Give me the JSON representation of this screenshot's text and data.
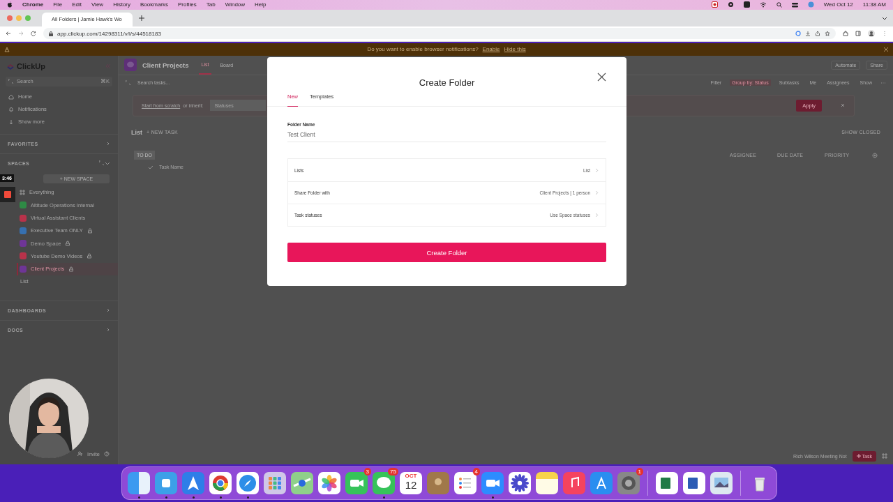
{
  "menubar": {
    "app": "Chrome",
    "menus": [
      "File",
      "Edit",
      "View",
      "History",
      "Bookmarks",
      "Profiles",
      "Tab",
      "Window",
      "Help"
    ],
    "date": "Wed Oct 12",
    "time": "11:38 AM"
  },
  "browser": {
    "tab_title": "All Folders | Jamie Hawk's Wo",
    "url": "app.clickup.com/14298311/v/l/s/44518183"
  },
  "notification": {
    "message": "Do you want to enable browser notifications?",
    "links": [
      "Enable",
      "Hide this"
    ]
  },
  "sidebar": {
    "logo": "ClickUp",
    "search_placeholder": "Search",
    "shortcut": "⌘K",
    "nav": [
      "Home",
      "Notifications",
      "Show more"
    ],
    "favorites": "FAVORITES",
    "spaces_label": "SPACES",
    "new_space": "+ NEW SPACE",
    "spaces": [
      {
        "kind": "everything",
        "name": "Everything",
        "locked": false,
        "selected": false
      },
      {
        "kind": "space",
        "name": "Altitude Operations Internal",
        "color": "#2e8a45",
        "locked": false,
        "selected": false
      },
      {
        "kind": "space",
        "name": "Virtual Assistant Clients",
        "color": "#b8324a",
        "locked": false,
        "selected": false
      },
      {
        "kind": "space",
        "name": "Executive Team ONLY",
        "color": "#3670b0",
        "locked": true,
        "selected": false
      },
      {
        "kind": "space",
        "name": "Demo Space",
        "color": "#6e3596",
        "locked": true,
        "selected": false
      },
      {
        "kind": "space",
        "name": "Youtube Demo Videos",
        "color": "#b8324a",
        "locked": true,
        "selected": false
      },
      {
        "kind": "space",
        "name": "Client Projects",
        "color": "#6e3596",
        "locked": true,
        "selected": true,
        "children": [
          {
            "name": "List"
          }
        ]
      }
    ],
    "dashboards": "DASHBOARDS",
    "docs": "DOCS",
    "invite": "Invite"
  },
  "recording": {
    "timer": "3:46"
  },
  "main": {
    "title": "Client Projects",
    "views": [
      {
        "label": "List",
        "selected": true
      },
      {
        "label": "Board",
        "selected": false
      }
    ],
    "actions": [
      "Automate",
      "Share"
    ],
    "search_placeholder": "Search tasks...",
    "toolbar": [
      {
        "label": "Filter",
        "active": false
      },
      {
        "label": "Group by: Status",
        "active": true
      },
      {
        "label": "Subtasks",
        "active": false
      },
      {
        "label": "Me",
        "active": false
      },
      {
        "label": "Assignees",
        "active": false
      },
      {
        "label": "Show",
        "active": false
      }
    ],
    "banner": {
      "link": "Start from scratch",
      "text": "or inherit:",
      "select": "Statuses",
      "apply": "Apply"
    },
    "list": {
      "title": "List",
      "new_task": "+ NEW TASK",
      "show_closed": "SHOW CLOSED",
      "group": "TO DO",
      "task_placeholder": "Task Name",
      "columns": [
        "ASSIGNEE",
        "DUE DATE",
        "PRIORITY"
      ]
    },
    "footer": {
      "doc": "Rich Wilson Meeting Not",
      "task_button": "Task"
    }
  },
  "modal": {
    "title": "Create Folder",
    "tabs": [
      {
        "label": "New",
        "selected": true
      },
      {
        "label": "Templates",
        "selected": false
      }
    ],
    "field": {
      "label": "Folder Name",
      "value": "Test Client"
    },
    "options": [
      {
        "label": "Lists",
        "value": "List"
      },
      {
        "label": "Share Folder with",
        "value": "Client Projects | 1 person"
      },
      {
        "label": "Task statuses",
        "value": "Use Space statuses"
      }
    ],
    "submit": "Create Folder"
  },
  "dock": [
    {
      "kind": "finder",
      "running": true
    },
    {
      "kind": "blue",
      "running": true
    },
    {
      "kind": "arrow",
      "running": true
    },
    {
      "kind": "chrome",
      "running": true
    },
    {
      "kind": "safari",
      "running": true
    },
    {
      "kind": "launchpad",
      "running": false
    },
    {
      "kind": "maps",
      "running": false
    },
    {
      "kind": "photos",
      "running": false
    },
    {
      "kind": "facetime",
      "running": false,
      "badge": "3"
    },
    {
      "kind": "messages",
      "running": true,
      "badge": "75"
    },
    {
      "kind": "calendar",
      "running": false,
      "month": "OCT",
      "day": "12"
    },
    {
      "kind": "contacts",
      "running": false
    },
    {
      "kind": "reminders",
      "running": false,
      "badge": "4"
    },
    {
      "kind": "zoom",
      "running": true
    },
    {
      "kind": "flower",
      "running": false
    },
    {
      "kind": "notes",
      "running": false
    },
    {
      "kind": "music",
      "running": false
    },
    {
      "kind": "appstore",
      "running": false
    },
    {
      "kind": "settings",
      "running": false,
      "badge": "1"
    },
    {
      "kind": "separator"
    },
    {
      "kind": "excel",
      "running": false
    },
    {
      "kind": "word",
      "running": false
    },
    {
      "kind": "preview",
      "running": false
    },
    {
      "kind": "separator"
    },
    {
      "kind": "trash",
      "running": false
    }
  ]
}
